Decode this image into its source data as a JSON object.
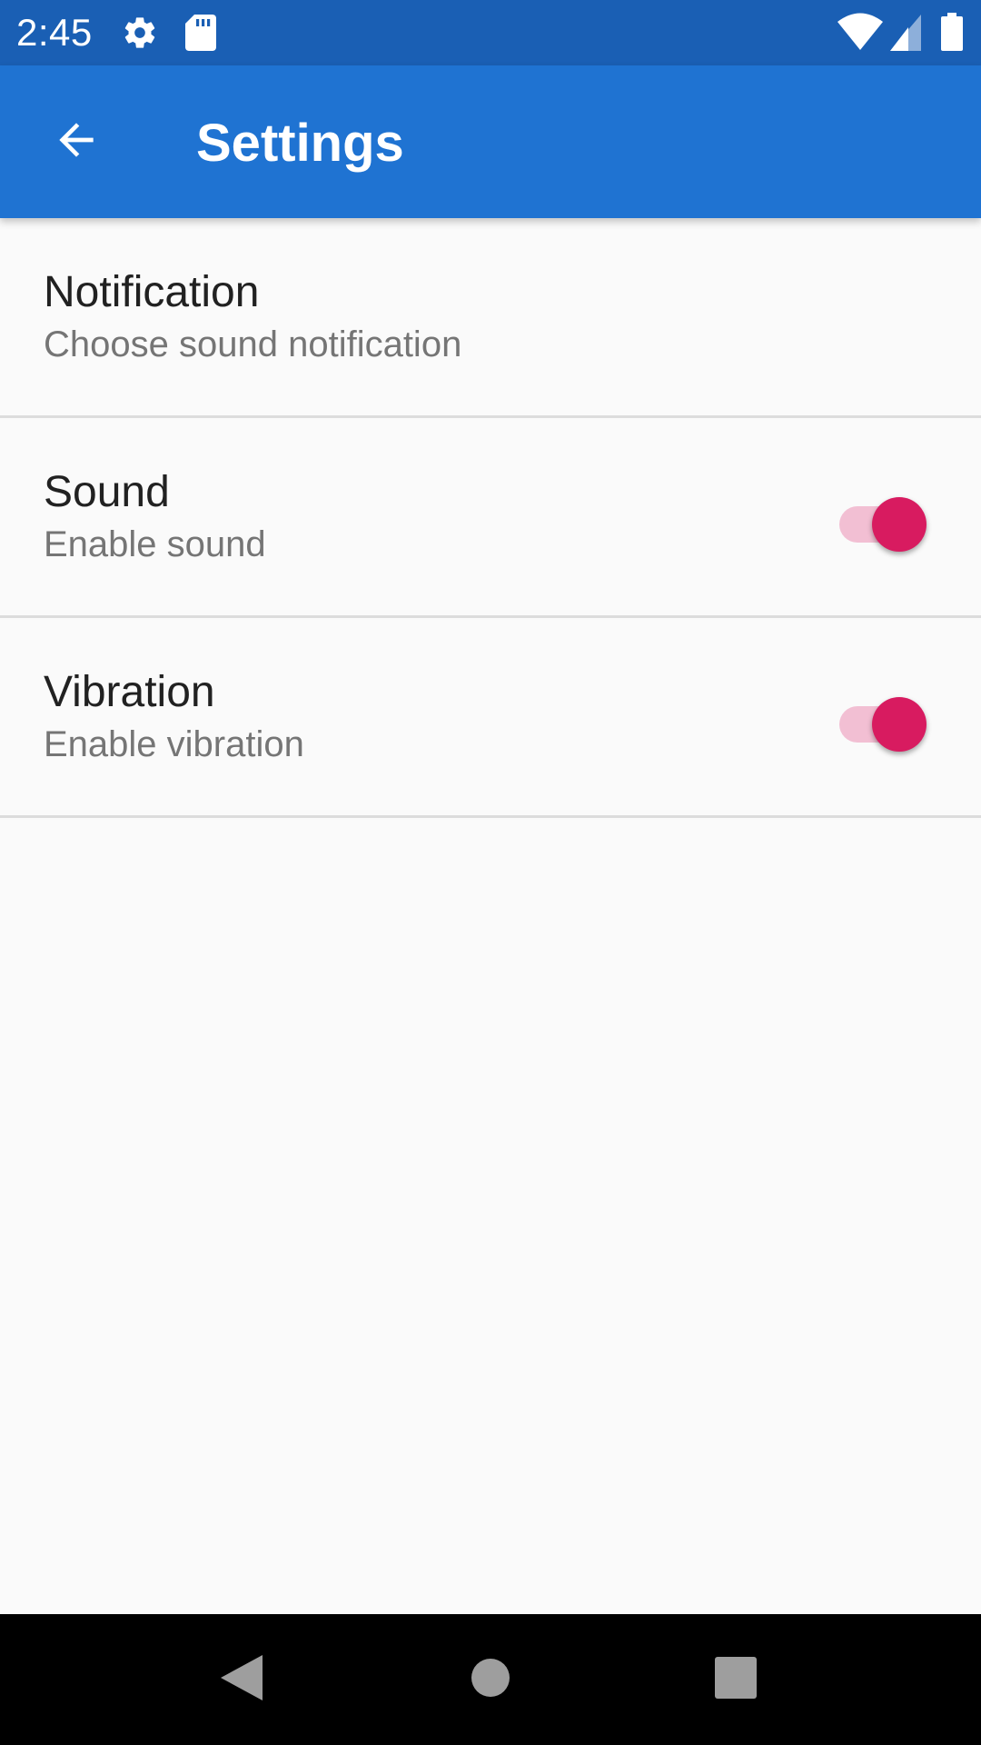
{
  "status_bar": {
    "time": "2:45",
    "icons": [
      "gear-icon",
      "sd-card-icon",
      "wifi-icon",
      "cell-signal-icon",
      "battery-icon"
    ]
  },
  "app_bar": {
    "title": "Settings",
    "back_icon": "arrow-back-icon",
    "background_color": "#1f73d2",
    "status_bar_color": "#1a5fb4"
  },
  "settings": {
    "items": [
      {
        "title": "Notification",
        "summary": "Choose sound notification"
      },
      {
        "title": "Sound",
        "summary": "Enable sound",
        "switch_on": true
      },
      {
        "title": "Vibration",
        "summary": "Enable vibration",
        "switch_on": true
      }
    ],
    "accent_color": "#d81b60"
  },
  "nav_bar": {
    "buttons": [
      "back-triangle-icon",
      "home-circle-icon",
      "recents-square-icon"
    ]
  }
}
